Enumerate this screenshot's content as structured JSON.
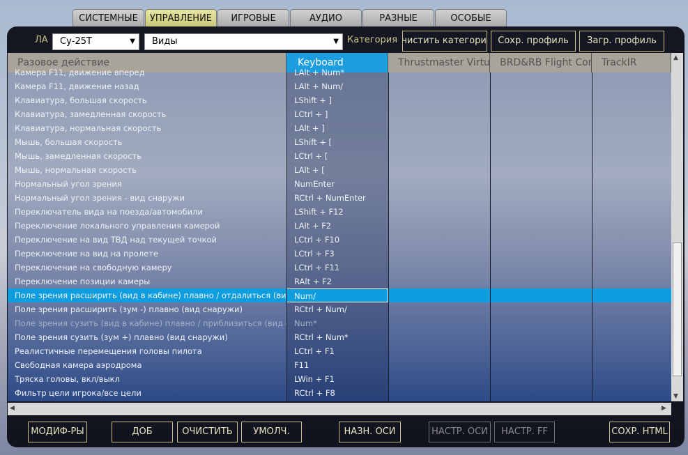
{
  "tabs": [
    "СИСТЕМНЫЕ",
    "УПРАВЛЕНИЕ",
    "ИГРОВЫЕ",
    "АУДИО",
    "РАЗНЫЕ",
    "ОСОБЫЕ"
  ],
  "active_tab": 1,
  "toolbar": {
    "aircraft_label": "ЛА",
    "aircraft_value": "Су-25Т",
    "view_value": "Виды",
    "category_label": "Категория",
    "clear_category": "Очистить категорию",
    "save_profile": "Сохр. профиль",
    "load_profile": "Загр. профиль"
  },
  "columns": [
    "Разовое действие",
    "Keyboard",
    "Thrustmaster Virtual",
    "BRD&RB Flight Cont",
    "TrackIR"
  ],
  "rows": [
    {
      "action": "Камера F11, движение вперед",
      "key": "LAlt + Num*"
    },
    {
      "action": "Камера F11, движение назад",
      "key": "LAlt + Num/"
    },
    {
      "action": "Клавиатура, большая скорость",
      "key": "LShift + ]"
    },
    {
      "action": "Клавиатура, замедленная скорость",
      "key": "LCtrl + ]"
    },
    {
      "action": "Клавиатура, нормальная скорость",
      "key": "LAlt + ]"
    },
    {
      "action": "Мышь, большая скорость",
      "key": "LShift + ["
    },
    {
      "action": "Мышь, замедленная скорость",
      "key": "LCtrl + ["
    },
    {
      "action": "Мышь, нормальная скорость",
      "key": "LAlt + ["
    },
    {
      "action": "Нормальный угол зрения",
      "key": "NumEnter"
    },
    {
      "action": "Нормальный угол зрения - вид снаружи",
      "key": "RCtrl + NumEnter"
    },
    {
      "action": "Переключатель вида на поезда/автомобили",
      "key": "LShift + F12"
    },
    {
      "action": "Переключение локального управления камерой",
      "key": "LAlt + F2"
    },
    {
      "action": "Переключение на вид ТВД над текущей точкой",
      "key": "LCtrl + F10"
    },
    {
      "action": "Переключение на вид на пролете",
      "key": "LCtrl + F3"
    },
    {
      "action": "Переключение на свободную камеру",
      "key": "LCtrl + F11"
    },
    {
      "action": "Переключение позиции камеры",
      "key": "RAlt + F2"
    },
    {
      "action": "Поле зрения расширить (вид в кабине) плавно / отдалиться (вид снаружи)",
      "key": "Num/"
    },
    {
      "action": "Поле зрения расширить (зум -) плавно (вид снаружи)",
      "key": "RCtrl + Num/"
    },
    {
      "action": "Поле зрения сузить (вид в кабине) плавно / приблизиться (вид снаружи)",
      "key": "Num*"
    },
    {
      "action": "Поле зрения сузить (зум +) плавно (вид снаружи)",
      "key": "RCtrl + Num*"
    },
    {
      "action": "Реалистичные перемещения головы пилота",
      "key": "LCtrl + F1"
    },
    {
      "action": "Свободная камера аэродрома",
      "key": "F11"
    },
    {
      "action": "Тряска головы, вкл/выкл",
      "key": "LWin + F1"
    },
    {
      "action": "Фильтр цели игрока/все цели",
      "key": "RCtrl + F8"
    }
  ],
  "selected_row": 16,
  "highlighted_row": 18,
  "bottom": {
    "modifiers": "МОДИФ-РЫ",
    "add": "ДОБ",
    "clear": "ОЧИСТИТЬ",
    "default": "УМОЛЧ.",
    "assign_axis": "НАЗН. ОСИ",
    "axis_settings": "НАСТР. ОСИ",
    "ff_settings": "НАСТР. FF",
    "save_html": "СОХР. HTML"
  }
}
